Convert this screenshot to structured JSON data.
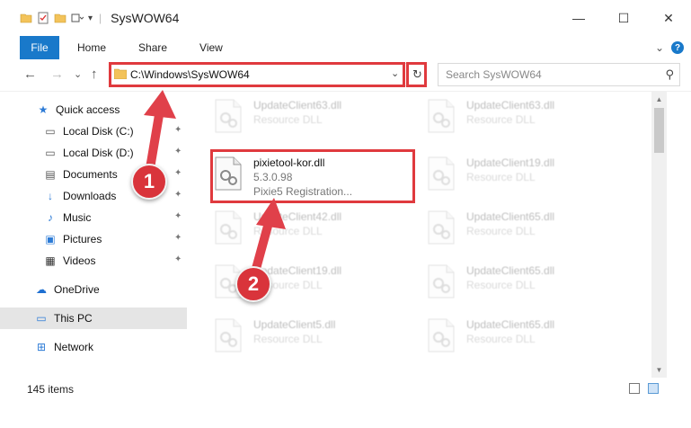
{
  "window": {
    "title": "SysWOW64",
    "minimize_label": "—",
    "maximize_label": "☐",
    "close_label": "✕"
  },
  "ribbon": {
    "tabs": [
      "File",
      "Home",
      "Share",
      "View"
    ],
    "expand_label": "⌄",
    "help_label": "?"
  },
  "nav": {
    "back_label": "←",
    "forward_label": "→",
    "recent_label": "⌄",
    "up_label": "↑",
    "address": "C:\\Windows\\SysWOW64",
    "refresh_label": "↻",
    "search_placeholder": "Search SysWOW64",
    "search_icon_label": "⚲"
  },
  "sidebar": {
    "items": [
      {
        "label": "Quick access",
        "icon": "star-icon",
        "glyph": "★",
        "color": "#2d7bd6",
        "pinned": false
      },
      {
        "label": "Local Disk (C:)",
        "icon": "drive-icon",
        "glyph": "▭",
        "color": "#555555",
        "pinned": true
      },
      {
        "label": "Local Disk (D:)",
        "icon": "drive-icon",
        "glyph": "▭",
        "color": "#555555",
        "pinned": true
      },
      {
        "label": "Documents",
        "icon": "documents-icon",
        "glyph": "▤",
        "color": "#555555",
        "pinned": true
      },
      {
        "label": "Downloads",
        "icon": "downloads-icon",
        "glyph": "↓",
        "color": "#2d7bd6",
        "pinned": true
      },
      {
        "label": "Music",
        "icon": "music-icon",
        "glyph": "♪",
        "color": "#2d7bd6",
        "pinned": true
      },
      {
        "label": "Pictures",
        "icon": "pictures-icon",
        "glyph": "▣",
        "color": "#2d7bd6",
        "pinned": true
      },
      {
        "label": "Videos",
        "icon": "videos-icon",
        "glyph": "▦",
        "color": "#333333",
        "pinned": true
      },
      {
        "label": "OneDrive",
        "icon": "cloud-icon",
        "glyph": "☁",
        "color": "#1e6fd1",
        "pinned": false
      },
      {
        "label": "This PC",
        "icon": "computer-icon",
        "glyph": "▭",
        "color": "#2d7bd6",
        "pinned": false,
        "selected": true
      },
      {
        "label": "Network",
        "icon": "network-icon",
        "glyph": "⊞",
        "color": "#2d7bd6",
        "pinned": false
      }
    ],
    "pin_glyph": "📌"
  },
  "files": {
    "left": [
      {
        "name": "UpdateClient63.dll",
        "sub1": "Resource DLL",
        "sub2": "",
        "faded": true
      },
      {
        "name": "pixietool-kor.dll",
        "sub1": "5.3.0.98",
        "sub2": "Pixie5 Registration...",
        "faded": false
      },
      {
        "name": "UpdateClient42.dll",
        "sub1": "Resource DLL",
        "sub2": "",
        "faded": true
      },
      {
        "name": "UpdateClient19.dll",
        "sub1": "Resource DLL",
        "sub2": "",
        "faded": true
      },
      {
        "name": "UpdateClient5.dll",
        "sub1": "Resource DLL",
        "sub2": "",
        "faded": true
      }
    ],
    "right": [
      {
        "name": "UpdateClient63.dll",
        "sub1": "Resource DLL",
        "sub2": "",
        "faded": true
      },
      {
        "name": "UpdateClient19.dll",
        "sub1": "Resource DLL",
        "sub2": "",
        "faded": true
      },
      {
        "name": "UpdateClient65.dll",
        "sub1": "Resource DLL",
        "sub2": "",
        "faded": true
      },
      {
        "name": "UpdateClient65.dll",
        "sub1": "Resource DLL",
        "sub2": "",
        "faded": true
      },
      {
        "name": "UpdateClient65.dll",
        "sub1": "Resource DLL",
        "sub2": "",
        "faded": true
      }
    ]
  },
  "status": {
    "item_count": "145 items"
  },
  "callouts": {
    "one": "1",
    "two": "2"
  },
  "colors": {
    "accent": "#1979ca",
    "highlight": "#e03a3e",
    "badge": "#d9343b"
  }
}
